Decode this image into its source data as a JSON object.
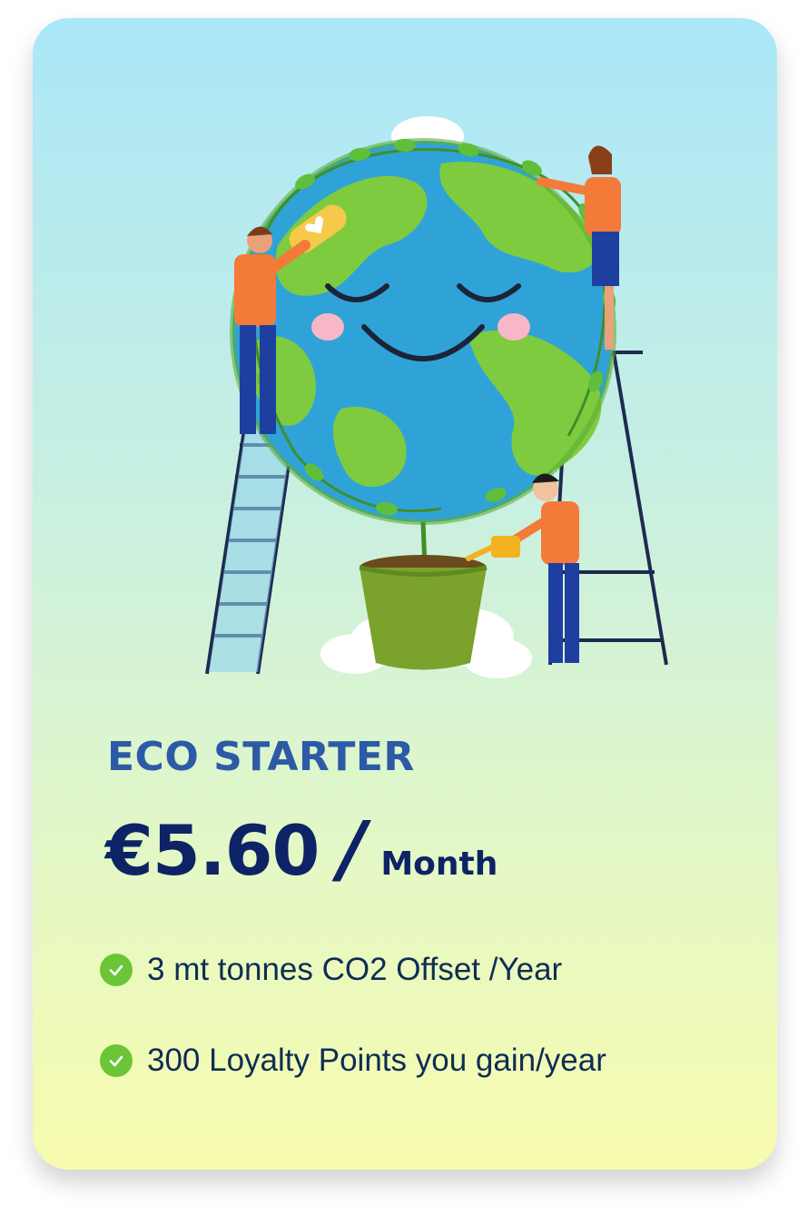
{
  "plan": {
    "name": "ECO STARTER",
    "price": "€5.60",
    "separator": "/",
    "period": "Month"
  },
  "features": [
    {
      "text": "3 mt tonnes CO2 Offset /Year",
      "icon": "check-circle-icon"
    },
    {
      "text": "300 Loyalty Points you gain/year",
      "icon": "check-circle-icon"
    }
  ],
  "illustration": {
    "subject": "smiling-earth-with-people-caring-for-it"
  },
  "colors": {
    "plan_name": "#2d5aa6",
    "price": "#0d2366",
    "feature_text": "#0e2d55",
    "check": "#6cc437",
    "card_top": "#abe7f8",
    "card_bottom": "#f7fbae"
  }
}
